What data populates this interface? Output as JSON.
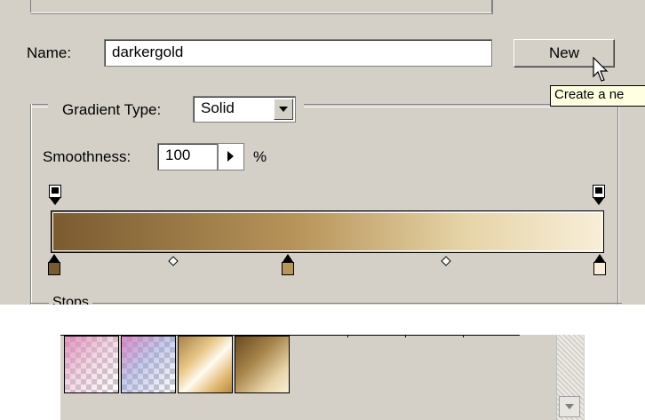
{
  "colors": {
    "panel": "#d4d0c8",
    "gradient_stops": [
      "#7a5a30",
      "#b8955a",
      "#e6d4a8",
      "#f8eed8"
    ]
  },
  "name_field": {
    "label": "Name:",
    "value": "darkergold"
  },
  "new_button": {
    "label": "New"
  },
  "tooltip": {
    "text": "Create a ne"
  },
  "gradient_type": {
    "label": "Gradient Type:",
    "selected": "Solid"
  },
  "smoothness": {
    "label": "Smoothness:",
    "value": "100",
    "unit": "%"
  },
  "stops_group": {
    "label": "Stops"
  },
  "presets": [
    {
      "name": "pink-transparent-preset"
    },
    {
      "name": "violet-transparent-preset"
    },
    {
      "name": "gold-preset"
    },
    {
      "name": "darkergold-preset"
    }
  ],
  "icons": {
    "select_arrow": "chevron-down-icon",
    "smooth_arrow": "triangle-right-icon",
    "scroll_down": "scroll-down-icon",
    "cursor": "pointer-cursor-icon"
  }
}
